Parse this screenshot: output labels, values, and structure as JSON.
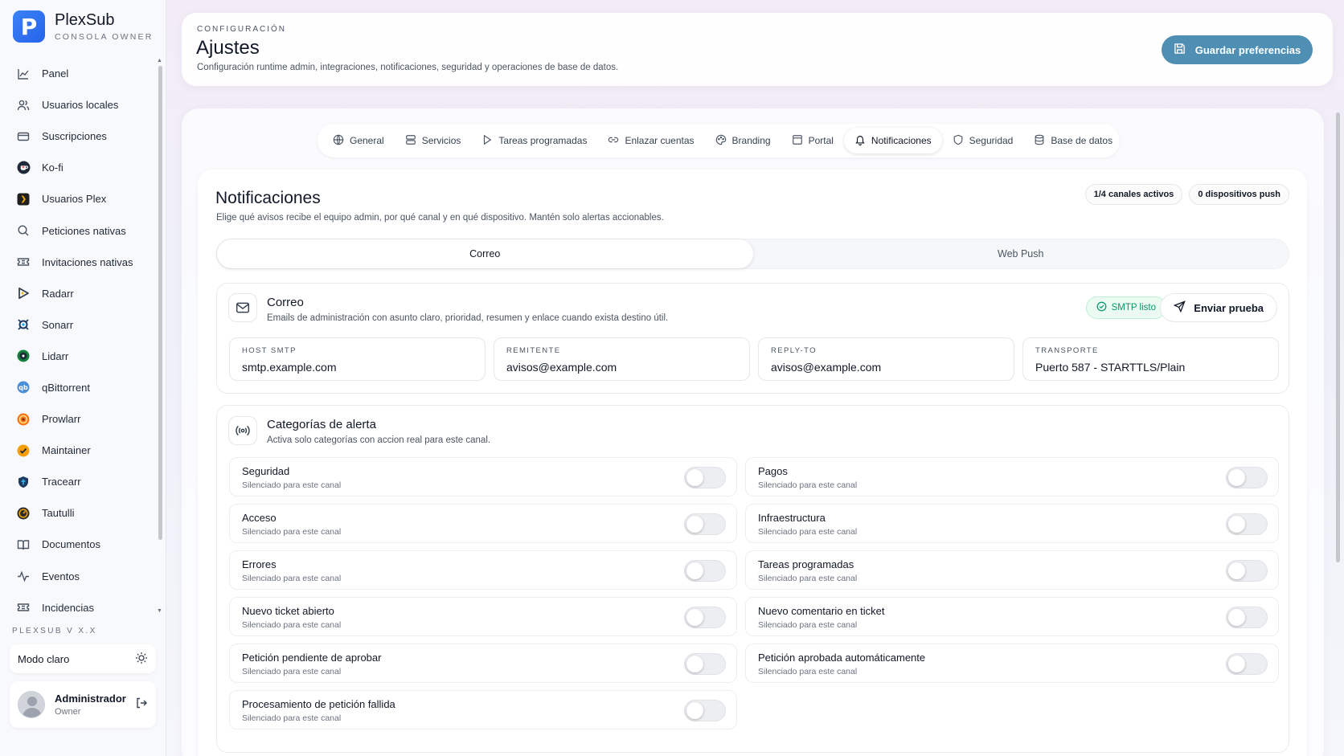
{
  "brand": {
    "name": "PlexSub",
    "subtitle": "CONSOLA OWNER",
    "logo_letter": "P",
    "color": "#2563eb"
  },
  "sidebar": {
    "items": [
      {
        "label": "Panel",
        "icon": "chart-line-icon"
      },
      {
        "label": "Usuarios locales",
        "icon": "users-icon"
      },
      {
        "label": "Suscripciones",
        "icon": "credit-card-icon"
      },
      {
        "label": "Ko-fi",
        "icon": "kofi-icon"
      },
      {
        "label": "Usuarios Plex",
        "icon": "plex-icon"
      },
      {
        "label": "Peticiones nativas",
        "icon": "search-icon"
      },
      {
        "label": "Invitaciones nativas",
        "icon": "ticket-icon"
      },
      {
        "label": "Radarr",
        "icon": "radarr-icon"
      },
      {
        "label": "Sonarr",
        "icon": "sonarr-icon"
      },
      {
        "label": "Lidarr",
        "icon": "lidarr-icon"
      },
      {
        "label": "qBittorrent",
        "icon": "qbittorrent-icon"
      },
      {
        "label": "Prowlarr",
        "icon": "prowlarr-icon"
      },
      {
        "label": "Maintainer",
        "icon": "maintainer-icon"
      },
      {
        "label": "Tracearr",
        "icon": "tracearr-icon"
      },
      {
        "label": "Tautulli",
        "icon": "tautulli-icon"
      },
      {
        "label": "Documentos",
        "icon": "book-icon"
      },
      {
        "label": "Eventos",
        "icon": "activity-icon"
      },
      {
        "label": "Incidencias",
        "icon": "ticket-icon"
      }
    ],
    "version": "PLEXSUB V X.X",
    "mode_label": "Modo claro",
    "user": {
      "name": "Administrador",
      "role": "Owner"
    }
  },
  "header": {
    "kicker": "CONFIGURACIÓN",
    "title": "Ajustes",
    "description": "Configuración runtime admin, integraciones, notificaciones, seguridad y operaciones de base de datos.",
    "save_label": "Guardar preferencias",
    "accent": "#4f8fb4"
  },
  "tabs": [
    {
      "label": "General",
      "icon": "globe-icon"
    },
    {
      "label": "Servicios",
      "icon": "server-icon"
    },
    {
      "label": "Tareas programadas",
      "icon": "play-icon"
    },
    {
      "label": "Enlazar cuentas",
      "icon": "link-icon"
    },
    {
      "label": "Branding",
      "icon": "palette-icon"
    },
    {
      "label": "Portal",
      "icon": "browser-icon"
    },
    {
      "label": "Notificaciones",
      "icon": "bell-icon",
      "active": true
    },
    {
      "label": "Seguridad",
      "icon": "shield-icon"
    },
    {
      "label": "Base de datos",
      "icon": "database-icon"
    }
  ],
  "notifications": {
    "title": "Notificaciones",
    "description": "Elige qué avisos recibe el equipo admin, por qué canal y en qué dispositivo. Mantén solo alertas accionables.",
    "badges": [
      "1/4 canales activos",
      "0 dispositivos push"
    ],
    "channels": [
      "Correo",
      "Web Push"
    ],
    "active_channel": "Correo"
  },
  "mail": {
    "title": "Correo",
    "description": "Emails de administración con asunto claro, prioridad, resumen y enlace cuando exista destino útil.",
    "status": "SMTP listo",
    "status_color": "#059669",
    "test_label": "Enviar prueba",
    "fields": [
      {
        "label": "HOST SMTP",
        "value": "smtp.example.com"
      },
      {
        "label": "REMITENTE",
        "value": "avisos@example.com"
      },
      {
        "label": "REPLY-TO",
        "value": "avisos@example.com"
      },
      {
        "label": "TRANSPORTE",
        "value": "Puerto 587 - STARTTLS/Plain"
      }
    ]
  },
  "categories": {
    "title": "Categorías de alerta",
    "description": "Activa solo categorías con accion real para este canal.",
    "items": [
      {
        "name": "Seguridad",
        "status": "Silenciado para este canal",
        "enabled": false
      },
      {
        "name": "Pagos",
        "status": "Silenciado para este canal",
        "enabled": false
      },
      {
        "name": "Acceso",
        "status": "Silenciado para este canal",
        "enabled": false
      },
      {
        "name": "Infraestructura",
        "status": "Silenciado para este canal",
        "enabled": false
      },
      {
        "name": "Errores",
        "status": "Silenciado para este canal",
        "enabled": false
      },
      {
        "name": "Tareas programadas",
        "status": "Silenciado para este canal",
        "enabled": false
      },
      {
        "name": "Nuevo ticket abierto",
        "status": "Silenciado para este canal",
        "enabled": false
      },
      {
        "name": "Nuevo comentario en ticket",
        "status": "Silenciado para este canal",
        "enabled": false
      },
      {
        "name": "Petición pendiente de aprobar",
        "status": "Silenciado para este canal",
        "enabled": false
      },
      {
        "name": "Petición aprobada automáticamente",
        "status": "Silenciado para este canal",
        "enabled": false
      },
      {
        "name": "Procesamiento de petición fallida",
        "status": "Silenciado para este canal",
        "enabled": false
      }
    ]
  }
}
